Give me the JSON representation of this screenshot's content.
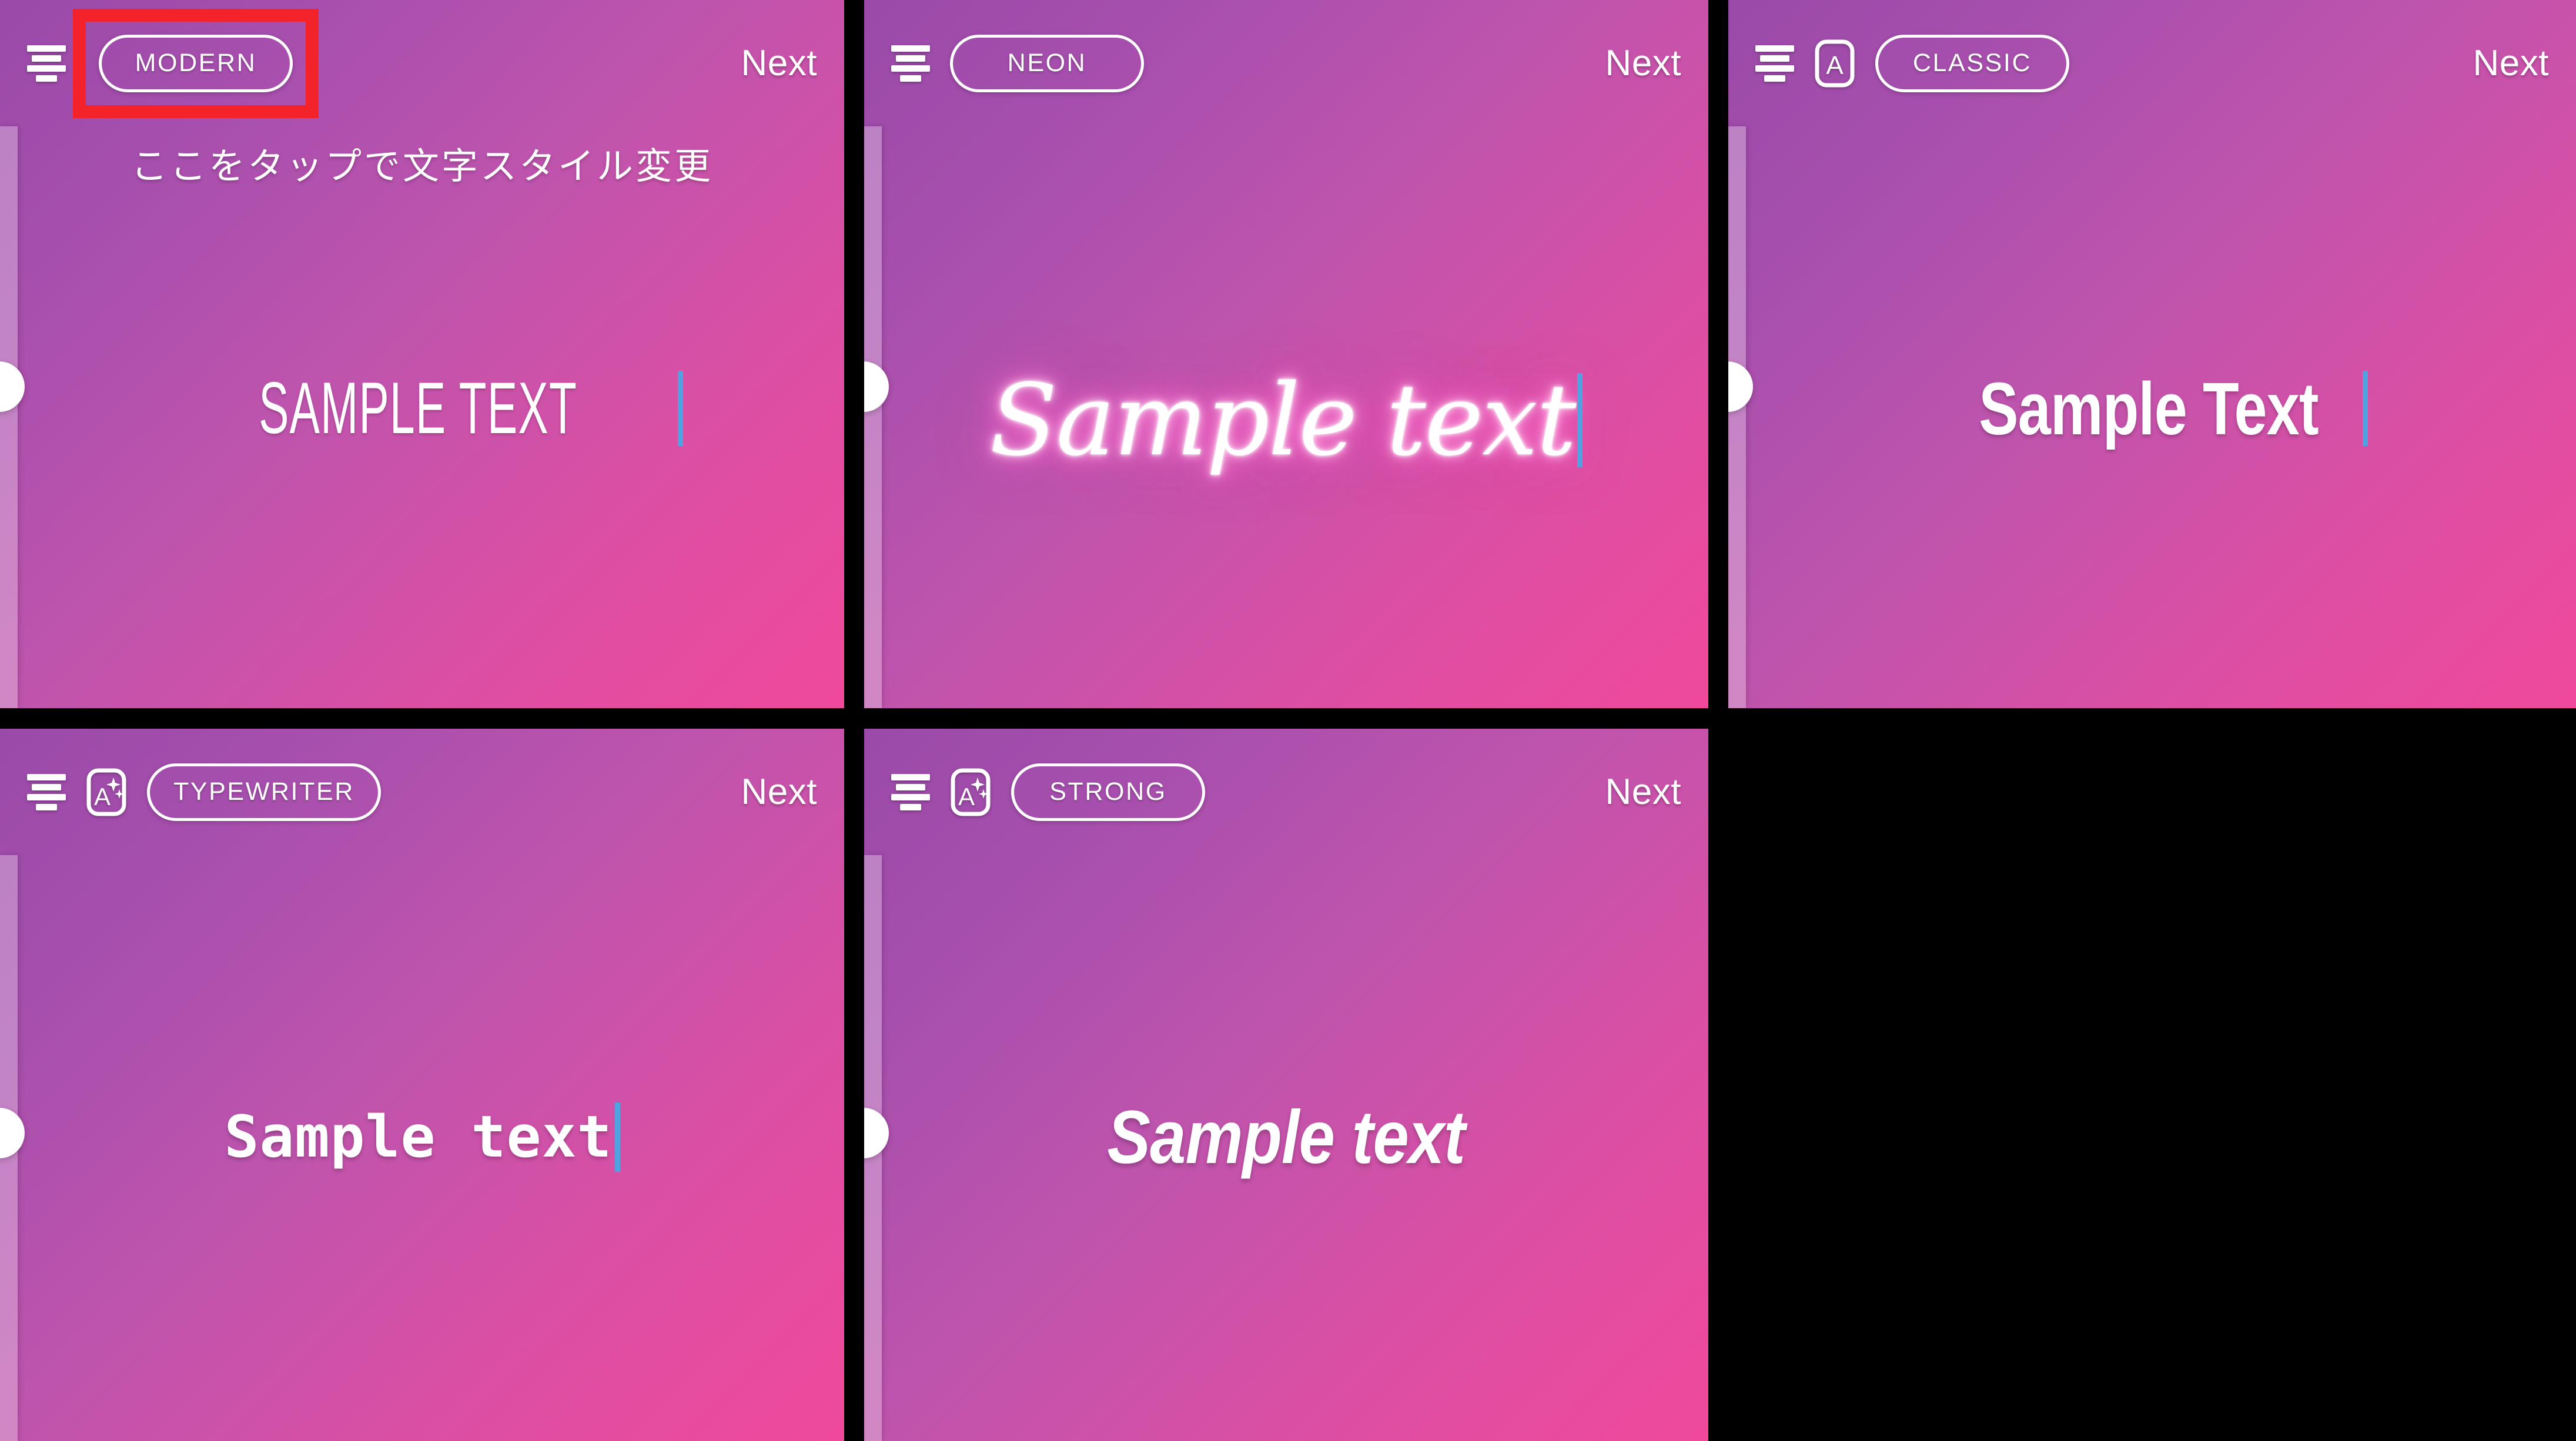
{
  "meta": {
    "screen_title": "Text style picker — 5 style variants",
    "accent_highlight_color": "#F42229",
    "caret_color": "#4EA3E0",
    "gradient_from": "#9A4AA9",
    "gradient_to": "#F0499B",
    "blank_cell_color": "#000000"
  },
  "common": {
    "next_label": "Next",
    "align_icon_name": "text-align-icon",
    "font_icon_name": "font-letter-icon",
    "font_magic_icon_name": "font-magic-icon",
    "drawer_handle_name": "drawer-handle"
  },
  "panels": [
    {
      "id": "modern",
      "style_label": "MODERN",
      "sample_text": "SAMPLE TEXT",
      "next_label": "Next",
      "caption": "ここをタップで文字スタイル変更",
      "has_caption": true,
      "has_font_icon": false,
      "font_icon_kind": "none",
      "highlighted": true,
      "has_caret": true,
      "text_class": "t-modern"
    },
    {
      "id": "neon",
      "style_label": "NEON",
      "sample_text": "Sample text",
      "next_label": "Next",
      "caption": "",
      "has_caption": false,
      "has_font_icon": false,
      "font_icon_kind": "none",
      "highlighted": false,
      "has_caret": true,
      "text_class": "t-neon"
    },
    {
      "id": "classic",
      "style_label": "CLASSIC",
      "sample_text": "Sample Text",
      "next_label": "Next",
      "caption": "",
      "has_caption": false,
      "has_font_icon": true,
      "font_icon_kind": "plain",
      "highlighted": false,
      "has_caret": true,
      "text_class": "t-classic"
    },
    {
      "id": "typewriter",
      "style_label": "TYPEWRITER",
      "sample_text": "Sample text",
      "next_label": "Next",
      "caption": "",
      "has_caption": false,
      "has_font_icon": true,
      "font_icon_kind": "magic",
      "highlighted": false,
      "has_caret": true,
      "text_class": "t-typewriter"
    },
    {
      "id": "strong",
      "style_label": "STRONG",
      "sample_text": "Sample text",
      "next_label": "Next",
      "caption": "",
      "has_caption": false,
      "has_font_icon": true,
      "font_icon_kind": "magic",
      "highlighted": false,
      "has_caret": false,
      "text_class": "t-strong"
    },
    {
      "id": "blank",
      "style_label": "",
      "sample_text": "",
      "next_label": "",
      "caption": "",
      "has_caption": false,
      "has_font_icon": false,
      "font_icon_kind": "none",
      "highlighted": false,
      "has_caret": false,
      "text_class": "",
      "blank": true
    }
  ]
}
